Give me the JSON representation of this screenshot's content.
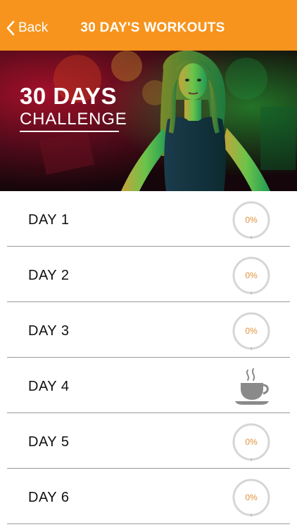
{
  "navbar": {
    "back_label": "Back",
    "title": "30 DAY'S WORKOUTS",
    "color": "#f7941d"
  },
  "hero": {
    "title": "30 DAYS",
    "subtitle": "CHALLENGE"
  },
  "days": [
    {
      "label": "DAY  1",
      "progress_text": "0%",
      "progress": 0,
      "rest": false
    },
    {
      "label": "DAY  2",
      "progress_text": "0%",
      "progress": 0,
      "rest": false
    },
    {
      "label": "DAY  3",
      "progress_text": "0%",
      "progress": 0,
      "rest": false
    },
    {
      "label": "DAY  4",
      "rest": true,
      "icon": "coffee-cup-icon"
    },
    {
      "label": "DAY  5",
      "progress_text": "0%",
      "progress": 0,
      "rest": false
    },
    {
      "label": "DAY  6",
      "progress_text": "0%",
      "progress": 0,
      "rest": false
    }
  ]
}
